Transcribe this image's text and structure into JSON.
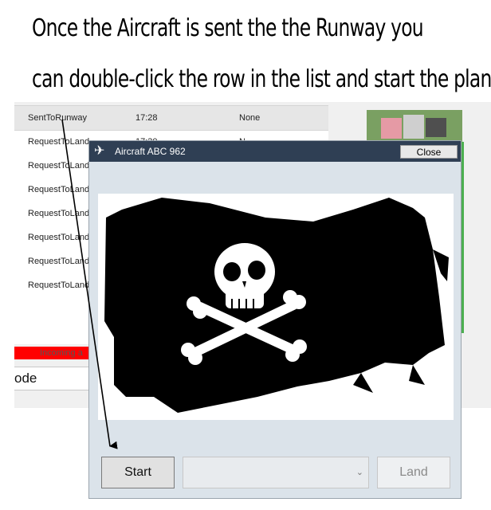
{
  "caption": {
    "line1": "Once the Aircraft is sent the the Runway you",
    "line2": "can double-click the row in the list and start the plane"
  },
  "background_app": {
    "rows": [
      {
        "status": "SentToRunway",
        "time": "17:28",
        "extra": "None"
      },
      {
        "status": "RequestToLand",
        "time": "17:30",
        "extra": "N"
      },
      {
        "status": "RequestToLand",
        "time": "",
        "extra": ""
      },
      {
        "status": "RequestToLand",
        "time": "",
        "extra": ""
      },
      {
        "status": "RequestToLand",
        "time": "",
        "extra": ""
      },
      {
        "status": "RequestToLand",
        "time": "",
        "extra": ""
      },
      {
        "status": "RequestToLand",
        "time": "",
        "extra": ""
      },
      {
        "status": "RequestToLand",
        "time": "",
        "extra": ""
      }
    ],
    "alert_text": "Incoming a",
    "code_field": "ode"
  },
  "dialog": {
    "title": "Aircraft ABC 962",
    "close_label": "Close",
    "image_icon": "pirate-flag-image",
    "start_label": "Start",
    "land_label": "Land",
    "combo_value": ""
  },
  "colors": {
    "titlebar": "#2f3f54",
    "dialog_bg": "#dbe3ea",
    "alert": "#ff0000"
  }
}
